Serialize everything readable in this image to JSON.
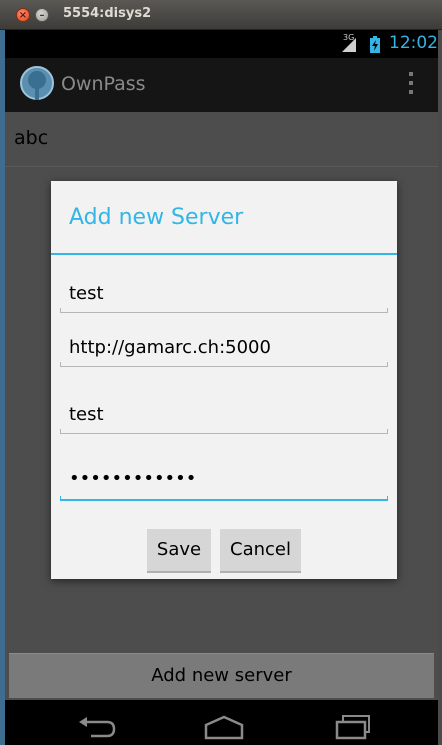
{
  "window": {
    "title": "5554:disys2",
    "close_symbol": "×",
    "minimize_symbol": "–"
  },
  "status_bar": {
    "network": "3G",
    "time": "12:02",
    "accent_color": "#33b5e5"
  },
  "action_bar": {
    "title": "OwnPass",
    "icon": "app-tree-icon",
    "menu_icon": "overflow-menu-icon"
  },
  "list": {
    "items": [
      {
        "label": "abc"
      }
    ]
  },
  "dialog": {
    "title": "Add new Server",
    "fields": [
      {
        "value": "test"
      },
      {
        "value": "http://gamarc.ch:5000"
      },
      {
        "value": "test"
      },
      {
        "value": "••••••••••••",
        "type": "password"
      }
    ],
    "save_label": "Save",
    "cancel_label": "Cancel"
  },
  "footer": {
    "add_server_label": "Add new server"
  },
  "nav_bar": {
    "icons": [
      "back-icon",
      "home-icon",
      "recents-icon"
    ]
  }
}
